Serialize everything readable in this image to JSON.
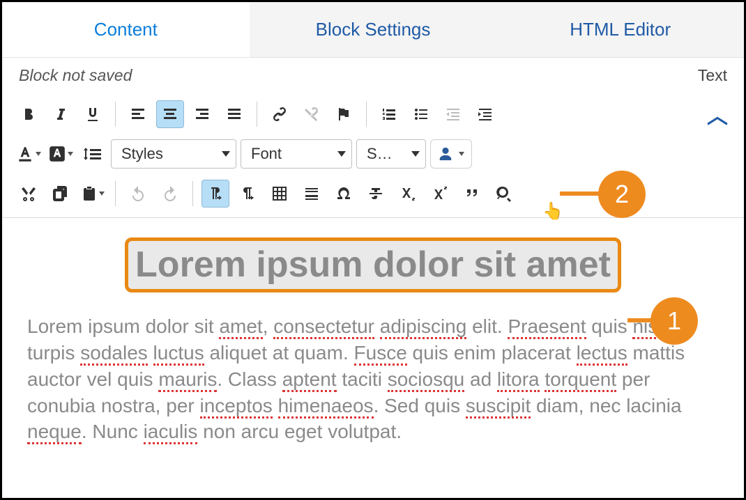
{
  "tabs": [
    {
      "label": "Content",
      "active": true
    },
    {
      "label": "Block Settings",
      "active": false
    },
    {
      "label": "HTML Editor",
      "active": false
    }
  ],
  "status": {
    "left": "Block not saved",
    "right": "Text"
  },
  "toolbar": {
    "styles_label": "Styles",
    "font_label": "Font",
    "size_label": "S…"
  },
  "callouts": {
    "one": "1",
    "two": "2"
  },
  "content": {
    "heading": "Lorem ipsum dolor sit amet",
    "p1a": "Lorem ipsum dolor sit ",
    "p1_amet": "amet",
    "p1b": ", ",
    "p1_cons": "consectetur",
    "p1c": " ",
    "p1_adip": "adipiscing",
    "p1d": " elit. ",
    "p1_prae": "Praesent",
    "p1e": " quis ",
    "p1_nisl": "nisl",
    "p1f": " in turpis ",
    "p1_sod": "sodales",
    "p1g": " ",
    "p1_luc": "luctus",
    "p1h": " aliquet at quam. ",
    "p1_fus": "Fusce",
    "p1i": " quis enim placerat ",
    "p1_lec": "lectus",
    "p1j": " mattis auctor vel quis ",
    "p1_mau": "mauris",
    "p1k": ". Class ",
    "p1_apt": "aptent",
    "p1l": " taciti ",
    "p1_soc": "sociosqu",
    "p1m": " ad ",
    "p1_lit": "litora",
    "p1n": " ",
    "p1_tor": "torquent",
    "p1o": " per conubia nostra, per ",
    "p1_inc": "inceptos",
    "p1p": " ",
    "p1_him": "himenaeos",
    "p1q": ". Sed quis ",
    "p1_sus": "suscipit",
    "p1r": " diam, nec lacinia ",
    "p1_neq": "neque",
    "p1s": ". Nunc ",
    "p1_iac": "iaculis",
    "p1t": " non arcu eget volutpat."
  }
}
